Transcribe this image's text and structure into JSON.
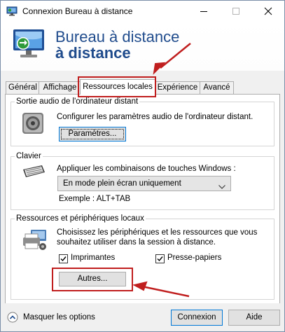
{
  "window": {
    "title": "Connexion Bureau à distance"
  },
  "banner": {
    "line1": "Bureau à distance",
    "line2": "à distance"
  },
  "tabs": [
    {
      "label": "Général"
    },
    {
      "label": "Affichage"
    },
    {
      "label": "Ressources locales"
    },
    {
      "label": "Expérience"
    },
    {
      "label": "Avancé"
    }
  ],
  "audio": {
    "legend": "Sortie audio de l'ordinateur distant",
    "description": "Configurer les paramètres audio de l'ordinateur distant.",
    "button": "Paramètres..."
  },
  "keyboard": {
    "legend": "Clavier",
    "description": "Appliquer les combinaisons de touches Windows :",
    "selected": "En mode plein écran uniquement",
    "example": "Exemple : ALT+TAB"
  },
  "local_resources": {
    "legend": "Ressources et périphériques locaux",
    "description_line1": "Choisissez les périphériques et les ressources que vous",
    "description_line2": "souhaitez utiliser dans la session à distance.",
    "printers_label": "Imprimantes",
    "printers_checked": true,
    "clipboard_label": "Presse-papiers",
    "clipboard_checked": true,
    "more_button": "Autres..."
  },
  "footer": {
    "options_label": "Masquer les options",
    "connect_button": "Connexion",
    "help_button": "Aide"
  },
  "colors": {
    "annotation": "#c01e1e",
    "banner_text": "#1f4b8c",
    "focus": "#0078d7"
  }
}
